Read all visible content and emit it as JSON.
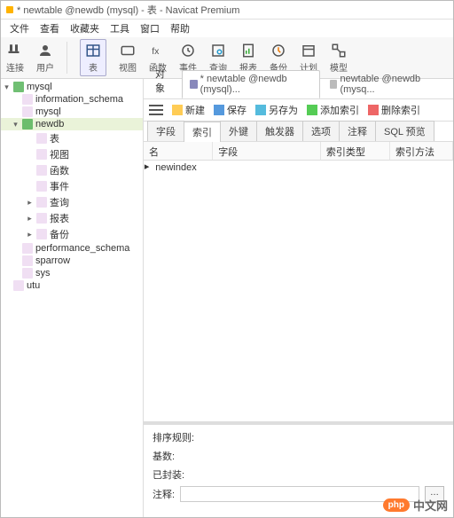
{
  "title": "* newtable @newdb (mysql) - 表 - Navicat Premium",
  "menu": [
    "文件",
    "查看",
    "收藏夹",
    "工具",
    "窗口",
    "帮助"
  ],
  "toolbar": [
    {
      "label": "连接",
      "icon": "plug",
      "sel": false
    },
    {
      "label": "用户",
      "icon": "user",
      "sel": false
    },
    {
      "label": "表",
      "icon": "table",
      "sel": true
    },
    {
      "label": "视图",
      "icon": "view",
      "sel": false
    },
    {
      "label": "函数",
      "icon": "fx",
      "sel": false
    },
    {
      "label": "事件",
      "icon": "clock",
      "sel": false
    },
    {
      "label": "查询",
      "icon": "query",
      "sel": false
    },
    {
      "label": "报表",
      "icon": "report",
      "sel": false
    },
    {
      "label": "备份",
      "icon": "backup",
      "sel": false
    },
    {
      "label": "计划",
      "icon": "sched",
      "sel": false
    },
    {
      "label": "模型",
      "icon": "model",
      "sel": false
    }
  ],
  "tree": [
    {
      "t": "▾",
      "lvl": 0,
      "label": "mysql",
      "on": true
    },
    {
      "t": "",
      "lvl": 1,
      "label": "information_schema",
      "on": false
    },
    {
      "t": "",
      "lvl": 1,
      "label": "mysql",
      "on": false
    },
    {
      "t": "▾",
      "lvl": 1,
      "label": "newdb",
      "on": true,
      "hl": true
    },
    {
      "t": "",
      "lvl": 2,
      "label": "表",
      "icon": "tbl"
    },
    {
      "t": "",
      "lvl": 2,
      "label": "视图",
      "icon": "oo"
    },
    {
      "t": "",
      "lvl": 2,
      "label": "函数",
      "icon": "fx"
    },
    {
      "t": "",
      "lvl": 2,
      "label": "事件",
      "icon": "ev"
    },
    {
      "t": "▸",
      "lvl": 2,
      "label": "查询",
      "icon": "qr"
    },
    {
      "t": "▸",
      "lvl": 2,
      "label": "报表",
      "icon": "rp"
    },
    {
      "t": "▸",
      "lvl": 2,
      "label": "备份",
      "icon": "bk"
    },
    {
      "t": "",
      "lvl": 1,
      "label": "performance_schema",
      "on": false
    },
    {
      "t": "",
      "lvl": 1,
      "label": "sparrow",
      "on": false
    },
    {
      "t": "",
      "lvl": 1,
      "label": "sys",
      "on": false
    },
    {
      "t": "",
      "lvl": 0,
      "label": "utu",
      "on": false
    }
  ],
  "uppertabs": {
    "obj": "对象",
    "t1": "* newtable @newdb (mysql)...",
    "t2": "newtable @newdb (mysq..."
  },
  "actions": {
    "new": "新建",
    "save": "保存",
    "saveas": "另存为",
    "addidx": "添加索引",
    "delidx": "删除索引"
  },
  "subtabs": [
    "字段",
    "索引",
    "外键",
    "触发器",
    "选项",
    "注释",
    "SQL 预览"
  ],
  "subtab_active": 1,
  "columns": {
    "name": "名",
    "fields": "字段",
    "idxtype": "索引类型",
    "idxmethod": "索引方法"
  },
  "rows": [
    {
      "name": "newindex",
      "fields": "",
      "idxtype": "",
      "idxmethod": ""
    }
  ],
  "props": {
    "sort": "排序规则:",
    "card": "基数:",
    "packed": "已封装:",
    "comment": "注释:"
  },
  "watermark": {
    "badge": "php",
    "text": "中文网"
  }
}
